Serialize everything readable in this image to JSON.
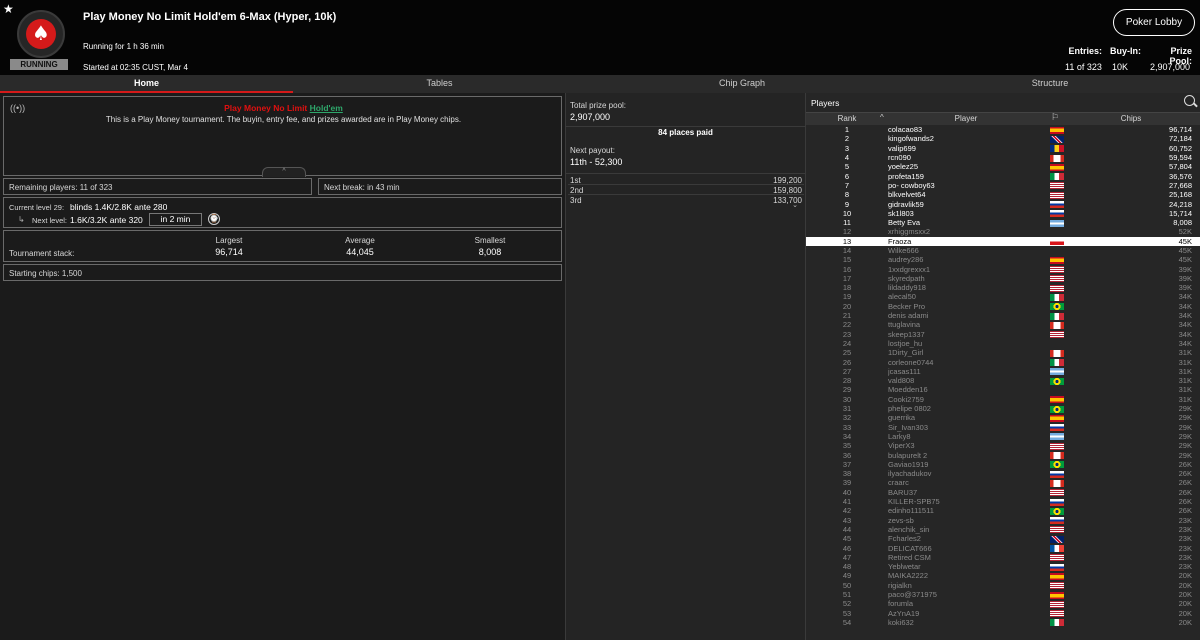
{
  "header": {
    "title": "Play Money No Limit Hold'em 6-Max (Hyper, 10k)",
    "running_for": "Running for 1 h 36 min",
    "started": "Started at 02:35 CUST, Mar 4",
    "status_badge": "RUNNING",
    "lobby_button": "Poker Lobby",
    "entries_label": "Entries:",
    "entries_value": "11 of 323",
    "buyin_label": "Buy-In:",
    "buyin_value": "10K",
    "prize_label": "Prize Pool:",
    "prize_value": "2,907,000"
  },
  "tabs": [
    "Home",
    "Tables",
    "Chip Graph",
    "Structure"
  ],
  "home": {
    "notice_title": "Play Money No Limit",
    "notice_link": "Hold'em",
    "notice_text": "This is a Play Money tournament. The buyin, entry fee, and prizes awarded are in Play Money chips.",
    "remaining": "Remaining players: 11 of 323",
    "next_break": "Next break: in 43 min",
    "current_level_label": "Current level 29:",
    "current_level_value": "blinds 1.4K/2.8K ante 280",
    "next_level_label": "Next level:",
    "next_level_value": "1.6K/3.2K ante 320",
    "next_level_time": "in 2 min",
    "stack_label": "Tournament stack:",
    "largest_label": "Largest",
    "largest_value": "96,714",
    "average_label": "Average",
    "average_value": "44,045",
    "smallest_label": "Smallest",
    "smallest_value": "8,008",
    "starting_chips": "Starting chips:  1,500"
  },
  "prizes": {
    "total_label": "Total prize pool:",
    "total_value": "2,907,000",
    "places_paid": "84 places paid",
    "next_payout_label": "Next payout:",
    "next_payout_value": "11th - 52,300",
    "rows": [
      {
        "place": "1st",
        "amount": "199,200"
      },
      {
        "place": "2nd",
        "amount": "159,800"
      },
      {
        "place": "3rd",
        "amount": "133,700"
      }
    ]
  },
  "players": {
    "title": "Players",
    "col_rank": "Rank",
    "col_player": "Player",
    "col_chips": "Chips",
    "rows": [
      {
        "rank": "1",
        "name": "colacao83",
        "chips": "96,714",
        "flag": "es",
        "state": "on"
      },
      {
        "rank": "2",
        "name": "kingofwands2",
        "chips": "72,184",
        "flag": "uk",
        "state": "on"
      },
      {
        "rank": "3",
        "name": "valip699",
        "chips": "60,752",
        "flag": "ro",
        "state": "on"
      },
      {
        "rank": "4",
        "name": "rcn090",
        "chips": "59,594",
        "flag": "ca",
        "state": "on"
      },
      {
        "rank": "5",
        "name": "yoelez25",
        "chips": "57,804",
        "flag": "es",
        "state": "on"
      },
      {
        "rank": "6",
        "name": "profeta159",
        "chips": "36,576",
        "flag": "it",
        "state": "on"
      },
      {
        "rank": "7",
        "name": "po- cowboy63",
        "chips": "27,668",
        "flag": "us",
        "state": "on"
      },
      {
        "rank": "8",
        "name": "blkvelvet64",
        "chips": "25,168",
        "flag": "us",
        "state": "on"
      },
      {
        "rank": "9",
        "name": "gidravlik59",
        "chips": "24,218",
        "flag": "ru",
        "state": "on"
      },
      {
        "rank": "10",
        "name": "sk1l803",
        "chips": "15,714",
        "flag": "ru",
        "state": "on"
      },
      {
        "rank": "11",
        "name": "Betty Eva",
        "chips": "8,008",
        "flag": "ar",
        "state": "on"
      },
      {
        "rank": "12",
        "name": "xrhiggmsxx2",
        "chips": "52K",
        "flag": "",
        "state": "off"
      },
      {
        "rank": "13",
        "name": "Fraoza",
        "chips": "45K",
        "flag": "cz",
        "state": "sel"
      },
      {
        "rank": "14",
        "name": "Wilke666",
        "chips": "45K",
        "flag": "",
        "state": "off"
      },
      {
        "rank": "15",
        "name": "audrey286",
        "chips": "45K",
        "flag": "es",
        "state": "off"
      },
      {
        "rank": "16",
        "name": "1xxdgrexxx1",
        "chips": "39K",
        "flag": "us",
        "state": "off"
      },
      {
        "rank": "17",
        "name": "skyredpath",
        "chips": "39K",
        "flag": "us",
        "state": "off"
      },
      {
        "rank": "18",
        "name": "lildaddy918",
        "chips": "39K",
        "flag": "us",
        "state": "off"
      },
      {
        "rank": "19",
        "name": "alecal50",
        "chips": "34K",
        "flag": "it",
        "state": "off"
      },
      {
        "rank": "20",
        "name": "Becker Pro",
        "chips": "34K",
        "flag": "br",
        "state": "off"
      },
      {
        "rank": "21",
        "name": "denis adami",
        "chips": "34K",
        "flag": "it",
        "state": "off"
      },
      {
        "rank": "22",
        "name": "ttuglavina",
        "chips": "34K",
        "flag": "ca",
        "state": "off"
      },
      {
        "rank": "23",
        "name": "skeep1337",
        "chips": "34K",
        "flag": "us",
        "state": "off"
      },
      {
        "rank": "24",
        "name": "lostjoe_hu",
        "chips": "34K",
        "flag": "",
        "state": "off"
      },
      {
        "rank": "25",
        "name": "1Dirty_Girl",
        "chips": "31K",
        "flag": "ca",
        "state": "off"
      },
      {
        "rank": "26",
        "name": "corleone0744",
        "chips": "31K",
        "flag": "it",
        "state": "off"
      },
      {
        "rank": "27",
        "name": "jcasas111",
        "chips": "31K",
        "flag": "ar",
        "state": "off"
      },
      {
        "rank": "28",
        "name": "vald808",
        "chips": "31K",
        "flag": "br",
        "state": "off"
      },
      {
        "rank": "29",
        "name": "Moedden16",
        "chips": "31K",
        "flag": "",
        "state": "off"
      },
      {
        "rank": "30",
        "name": "Cooki2759",
        "chips": "31K",
        "flag": "es",
        "state": "off"
      },
      {
        "rank": "31",
        "name": "phelipe 0802",
        "chips": "29K",
        "flag": "br",
        "state": "off"
      },
      {
        "rank": "32",
        "name": "guerrika",
        "chips": "29K",
        "flag": "es",
        "state": "off"
      },
      {
        "rank": "33",
        "name": "Sir_Ivan303",
        "chips": "29K",
        "flag": "ru",
        "state": "off"
      },
      {
        "rank": "34",
        "name": "Larky8",
        "chips": "29K",
        "flag": "ar",
        "state": "off"
      },
      {
        "rank": "35",
        "name": "ViperX3",
        "chips": "29K",
        "flag": "us",
        "state": "off"
      },
      {
        "rank": "36",
        "name": "bulapurelt 2",
        "chips": "29K",
        "flag": "ca",
        "state": "off"
      },
      {
        "rank": "37",
        "name": "Gaviao1919",
        "chips": "26K",
        "flag": "br",
        "state": "off"
      },
      {
        "rank": "38",
        "name": "ilyachadukov",
        "chips": "26K",
        "flag": "ru",
        "state": "off"
      },
      {
        "rank": "39",
        "name": "craarc",
        "chips": "26K",
        "flag": "ca",
        "state": "off"
      },
      {
        "rank": "40",
        "name": "BARU37",
        "chips": "26K",
        "flag": "us",
        "state": "off"
      },
      {
        "rank": "41",
        "name": "KILLER-SPB75",
        "chips": "26K",
        "flag": "ru",
        "state": "off"
      },
      {
        "rank": "42",
        "name": "edinho111511",
        "chips": "26K",
        "flag": "br",
        "state": "off"
      },
      {
        "rank": "43",
        "name": "zevs-sb",
        "chips": "23K",
        "flag": "ru",
        "state": "off"
      },
      {
        "rank": "44",
        "name": "alenchik_sin",
        "chips": "23K",
        "flag": "us",
        "state": "off"
      },
      {
        "rank": "45",
        "name": "Fcharles2",
        "chips": "23K",
        "flag": "uk",
        "state": "off"
      },
      {
        "rank": "46",
        "name": "DELICAT666",
        "chips": "23K",
        "flag": "fr",
        "state": "off"
      },
      {
        "rank": "47",
        "name": "Retired CSM",
        "chips": "23K",
        "flag": "us",
        "state": "off"
      },
      {
        "rank": "48",
        "name": "Yeblwetar",
        "chips": "23K",
        "flag": "ru",
        "state": "off"
      },
      {
        "rank": "49",
        "name": "MAIKA2222",
        "chips": "20K",
        "flag": "es",
        "state": "off"
      },
      {
        "rank": "50",
        "name": "rigialkn",
        "chips": "20K",
        "flag": "us",
        "state": "off"
      },
      {
        "rank": "51",
        "name": "paco@371975",
        "chips": "20K",
        "flag": "es",
        "state": "off"
      },
      {
        "rank": "52",
        "name": "forumla",
        "chips": "20K",
        "flag": "us",
        "state": "off"
      },
      {
        "rank": "53",
        "name": "AzYnA19",
        "chips": "20K",
        "flag": "us",
        "state": "off"
      },
      {
        "rank": "54",
        "name": "koki632",
        "chips": "20K",
        "flag": "it",
        "state": "off"
      }
    ]
  },
  "colors": {
    "accent_red": "#d51a1a",
    "link_green": "#2ea66a",
    "background": "#1b1b1b",
    "header_bg": "#050505"
  }
}
